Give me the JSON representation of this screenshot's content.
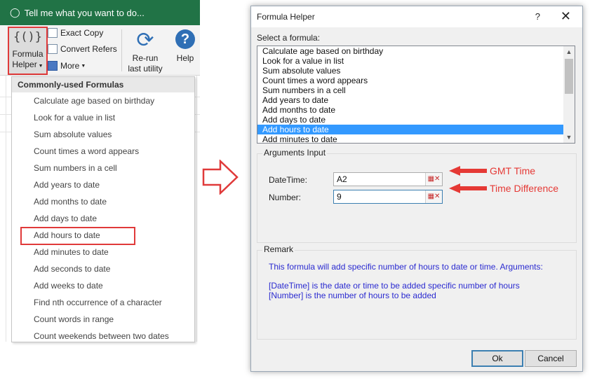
{
  "excel": {
    "tell_me": "Tell me what you want to do...",
    "ribbon": {
      "formula_helper_line1": "Formula",
      "formula_helper_line2": "Helper",
      "formula_helper_glyph": "{()}",
      "exact_copy": "Exact Copy",
      "convert_refers": "Convert Refers",
      "more": "More",
      "rerun_line1": "Re-run",
      "rerun_line2": "last utility",
      "help": "Help"
    },
    "menu": {
      "header": "Commonly-used Formulas",
      "items": [
        "Calculate age based on birthday",
        "Look for a value in list",
        "Sum absolute values",
        "Count times a word appears",
        "Sum numbers in a cell",
        "Add years to date",
        "Add months to date",
        "Add days to date",
        "Add hours to date",
        "Add minutes to date",
        "Add seconds to date",
        "Add weeks to date",
        "Find nth occurrence of a character",
        "Count words in range",
        "Count weekends between two dates"
      ],
      "highlighted_index": 8
    }
  },
  "dialog": {
    "title": "Formula Helper",
    "title_help": "?",
    "title_close": "✕",
    "select_label": "Select a formula:",
    "formulas": [
      "Calculate age based on birthday",
      "Look for a value in list",
      "Sum absolute values",
      "Count times a word appears",
      "Sum numbers in a cell",
      "Add years to date",
      "Add months to date",
      "Add days to date",
      "Add hours to date",
      "Add minutes to date"
    ],
    "selected_index": 8,
    "arguments": {
      "title": "Arguments Input",
      "datetime_label": "DateTime:",
      "datetime_value": "A2",
      "number_label": "Number:",
      "number_value": "9"
    },
    "remark": {
      "title": "Remark",
      "line1": "This formula will add specific number of hours to date or time. Arguments:",
      "line2": "[DateTime] is the date or time to be added specific number of hours",
      "line3": "[Number] is the number of hours to be added"
    },
    "ok_label": "Ok",
    "cancel_label": "Cancel"
  },
  "annotations": {
    "gmt": "GMT Time",
    "diff": "Time Difference",
    "color": "#e53935"
  }
}
